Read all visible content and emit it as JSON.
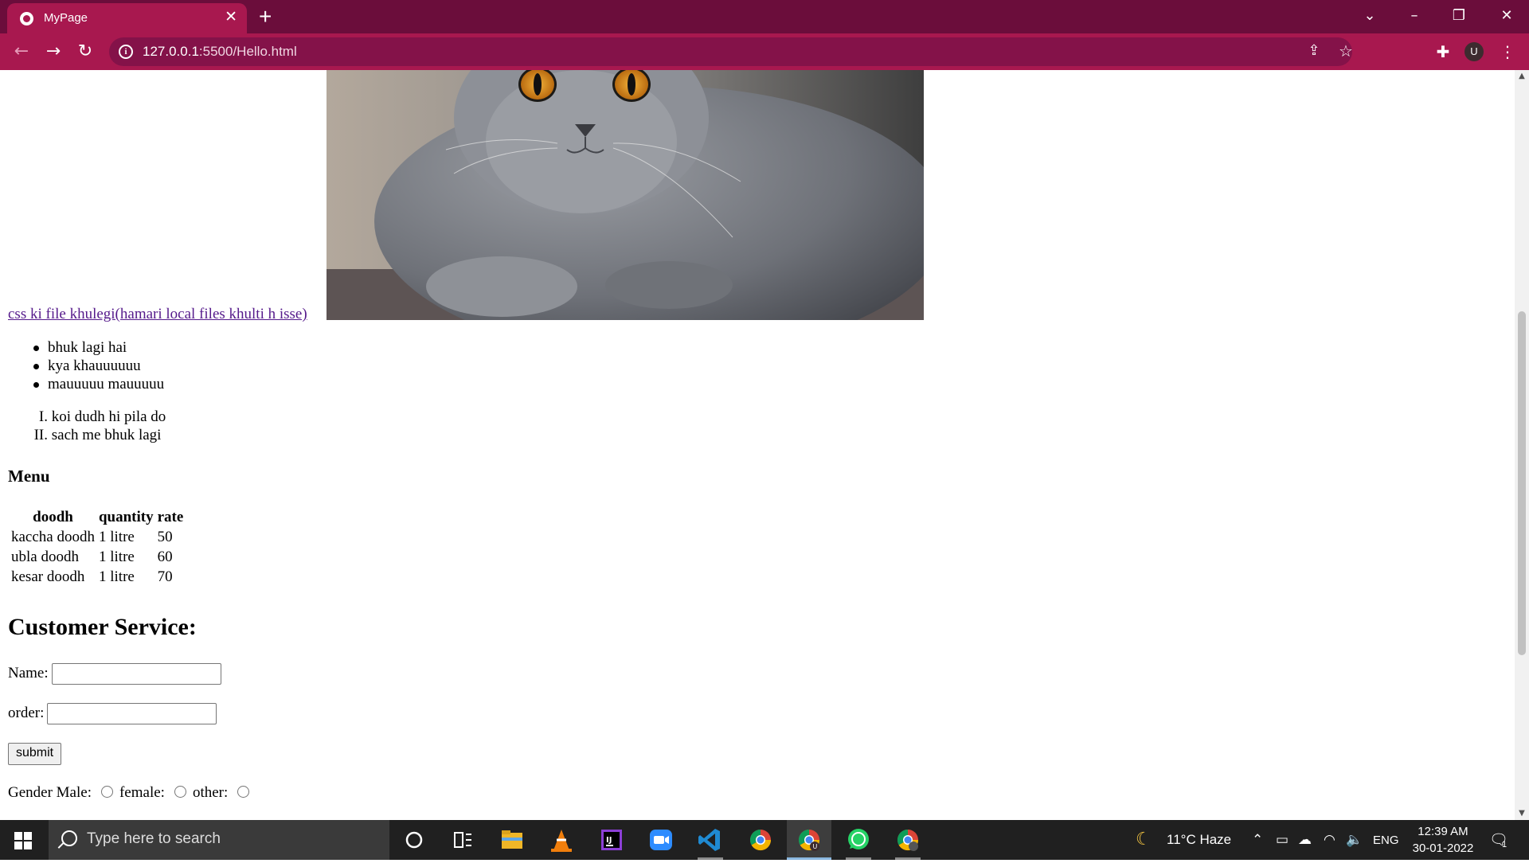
{
  "browser": {
    "tab_title": "MyPage",
    "tab_close": "✕",
    "new_tab": "+",
    "url_host": "127.0.0.1",
    "url_rest": ":5500/Hello.html",
    "profile_initial": "U"
  },
  "page": {
    "link_text": "css ki file khulegi(hamari local files khulti h isse)",
    "unordered_list": [
      "bhuk lagi hai",
      "kya khauuuuuu",
      "mauuuuu mauuuuu"
    ],
    "ordered_list": [
      {
        "num": "I.",
        "text": "koi dudh hi pila do"
      },
      {
        "num": "II.",
        "text": "sach me bhuk lagi"
      }
    ],
    "menu_heading": "Menu",
    "table": {
      "headers": [
        "doodh",
        "quantity",
        "rate"
      ],
      "rows": [
        [
          "kaccha doodh",
          "1 litre",
          "50"
        ],
        [
          "ubla doodh",
          "1 litre",
          "60"
        ],
        [
          "kesar doodh",
          "1 litre",
          "70"
        ]
      ]
    },
    "form": {
      "heading": "Customer Service:",
      "name_label": "Name:",
      "order_label": "order:",
      "submit_label": "submit",
      "gender_label": "Gender Male:",
      "female_label": "female:",
      "other_label": "other:"
    }
  },
  "taskbar": {
    "search_placeholder": "Type here to search",
    "weather": "11°C  Haze",
    "language": "ENG",
    "time": "12:39 AM",
    "date": "30-01-2022",
    "notification_count": "1"
  }
}
